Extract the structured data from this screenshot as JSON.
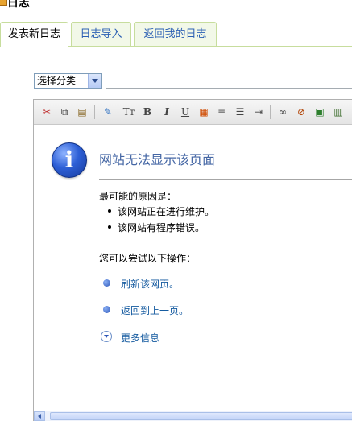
{
  "page": {
    "title": "日志"
  },
  "tabs": [
    {
      "label": "发表新日志",
      "active": true
    },
    {
      "label": "日志导入",
      "active": false
    },
    {
      "label": "返回我的日志",
      "active": false
    }
  ],
  "form": {
    "category": {
      "selected": "选择分类"
    },
    "title_input": {
      "value": ""
    }
  },
  "toolbar": {
    "buttons": [
      "cut-icon",
      "copy-icon",
      "paste-icon",
      "format-painter-icon",
      "font-size-icon",
      "bold-icon",
      "italic-icon",
      "underline-icon",
      "font-color-icon",
      "align-icon",
      "unordered-list-icon",
      "indent-icon",
      "link-icon",
      "unlink-icon",
      "image-icon",
      "media-icon"
    ],
    "labels": {
      "font_size": "Tт",
      "bold": "B",
      "italic": "I",
      "underline": "U"
    }
  },
  "error_page": {
    "title": "网站无法显示该页面",
    "reason_heading": "最可能的原因是：",
    "reasons": [
      "该网站正在进行维护。",
      "该网站有程序错误。"
    ],
    "try_heading": "您可以尝试以下操作：",
    "actions": [
      "刷新该网页。",
      "返回到上一页。",
      "更多信息"
    ]
  }
}
